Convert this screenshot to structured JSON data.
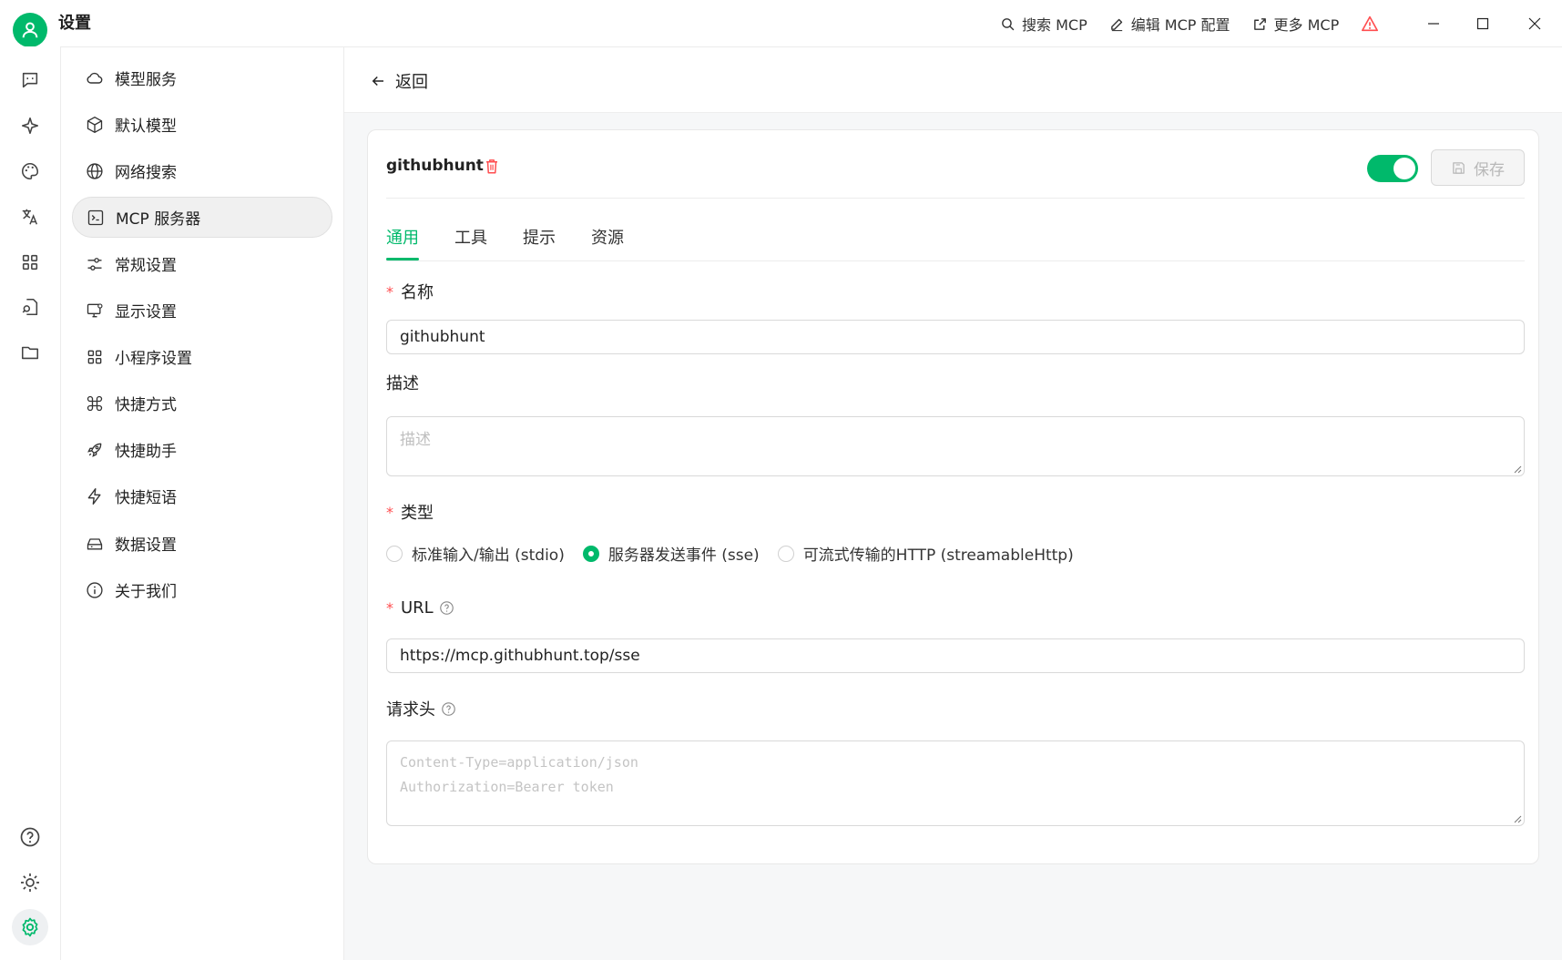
{
  "app": {
    "title": "设置"
  },
  "titlebar": {
    "actions": [
      {
        "icon": "search-icon",
        "label": "搜索 MCP"
      },
      {
        "icon": "edit-icon",
        "label": "编辑 MCP 配置"
      },
      {
        "icon": "external-link-icon",
        "label": "更多 MCP"
      }
    ],
    "warning_icon": "warning-icon",
    "window_controls": [
      "minimize",
      "maximize",
      "close"
    ]
  },
  "rail": {
    "top": [
      "chat-icon",
      "sparkle-icon",
      "palette-icon",
      "translate-icon",
      "apps-grid-icon",
      "document-search-icon",
      "folder-icon"
    ],
    "bottom": [
      "help-icon",
      "theme-sun-icon",
      "settings-gear-icon"
    ]
  },
  "nav": {
    "items": [
      {
        "icon": "cloud-icon",
        "label": "模型服务"
      },
      {
        "icon": "cube-icon",
        "label": "默认模型"
      },
      {
        "icon": "globe-icon",
        "label": "网络搜索"
      },
      {
        "icon": "terminal-icon",
        "label": "MCP 服务器",
        "active": true
      },
      {
        "icon": "sliders-icon",
        "label": "常规设置"
      },
      {
        "icon": "monitor-icon",
        "label": "显示设置"
      },
      {
        "icon": "grid-icon",
        "label": "小程序设置"
      },
      {
        "icon": "command-icon",
        "label": "快捷方式"
      },
      {
        "icon": "rocket-icon",
        "label": "快捷助手"
      },
      {
        "icon": "bolt-icon",
        "label": "快捷短语"
      },
      {
        "icon": "drive-icon",
        "label": "数据设置"
      },
      {
        "icon": "info-icon",
        "label": "关于我们"
      }
    ]
  },
  "main": {
    "back_label": "返回",
    "server": {
      "name": "githubhunt",
      "enabled": true,
      "save_label": "保存"
    },
    "tabs": [
      "通用",
      "工具",
      "提示",
      "资源"
    ],
    "form": {
      "name_label": "名称",
      "name_value": "githubhunt",
      "desc_label": "描述",
      "desc_placeholder": "描述",
      "type_label": "类型",
      "type_options": [
        {
          "label": "标准输入/输出 (stdio)",
          "selected": false
        },
        {
          "label": "服务器发送事件 (sse)",
          "selected": true
        },
        {
          "label": "可流式传输的HTTP (streamableHttp)",
          "selected": false
        }
      ],
      "url_label": "URL",
      "url_value": "https://mcp.githubhunt.top/sse",
      "headers_label": "请求头",
      "headers_placeholder": "Content-Type=application/json\nAuthorization=Bearer token"
    }
  },
  "colors": {
    "accent": "#00b96b",
    "required": "#ff4d4f",
    "warning": "#ff4d4f"
  }
}
